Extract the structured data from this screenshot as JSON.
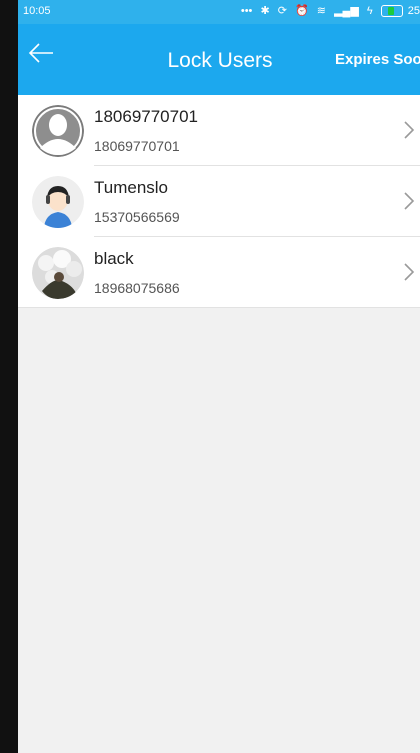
{
  "status_bar": {
    "time": "10:05",
    "icons": [
      "more-dots-icon",
      "bluetooth-icon",
      "sync-icon",
      "alarm-icon",
      "wifi-icon",
      "signal-icon",
      "charging-icon",
      "battery-icon"
    ],
    "battery_level": "25"
  },
  "header": {
    "title": "Lock Users",
    "action_label": "Expires Soon",
    "back_icon": "arrow-left-icon"
  },
  "users": [
    {
      "name": "18069770701",
      "phone": "18069770701",
      "avatar": "default-gray"
    },
    {
      "name": "Tumenslo",
      "phone": "15370566569",
      "avatar": "cartoon-boy"
    },
    {
      "name": "black",
      "phone": "18968075686",
      "avatar": "photo"
    }
  ],
  "colors": {
    "status_bar": "#2fb1ec",
    "app_bar": "#1ca8ee",
    "background": "#f1f1f1",
    "battery_fill": "#1ccb3c"
  }
}
